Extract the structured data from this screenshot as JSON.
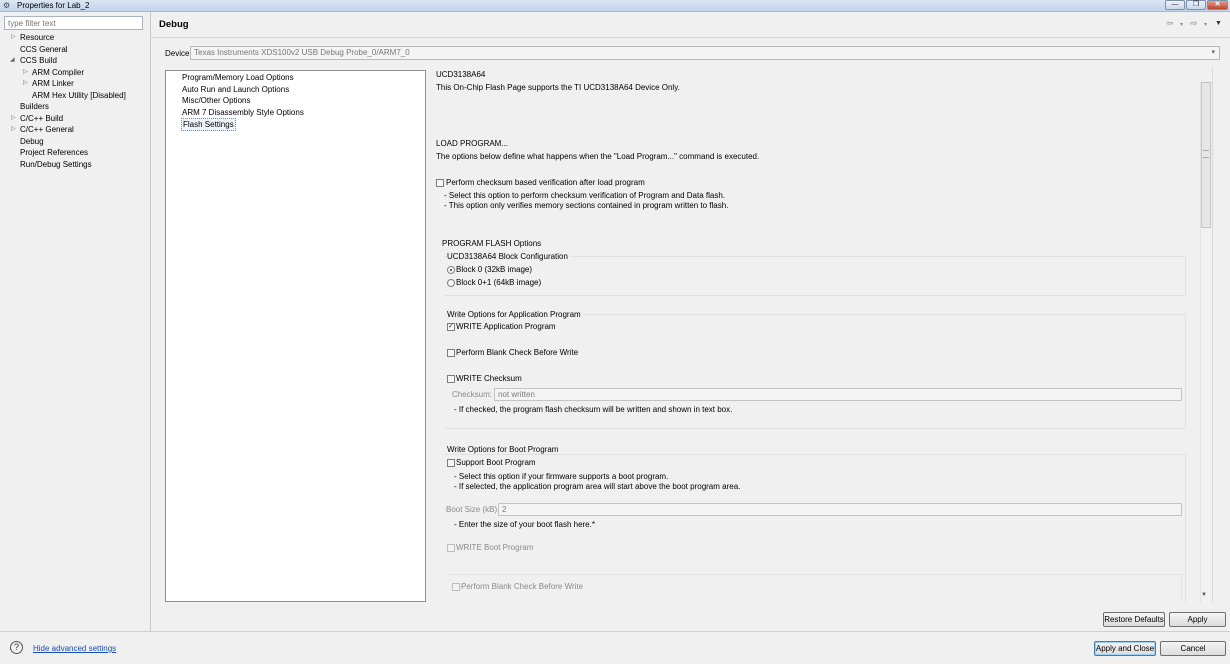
{
  "window": {
    "title": "Properties for Lab_2"
  },
  "filter": {
    "placeholder": "type filter text"
  },
  "tree": [
    {
      "label": "Resource",
      "arrow": "▷"
    },
    {
      "label": "CCS General",
      "arrow": ""
    },
    {
      "label": "CCS Build",
      "arrow": "◢"
    },
    {
      "label": "ARM Compiler",
      "arrow": "▷"
    },
    {
      "label": "ARM Linker",
      "arrow": "▷"
    },
    {
      "label": "ARM Hex Utility  [Disabled]",
      "arrow": ""
    },
    {
      "label": "Builders",
      "arrow": ""
    },
    {
      "label": "C/C++ Build",
      "arrow": "▷"
    },
    {
      "label": "C/C++ General",
      "arrow": "▷"
    },
    {
      "label": "Debug",
      "arrow": ""
    },
    {
      "label": "Project References",
      "arrow": ""
    },
    {
      "label": "Run/Debug Settings",
      "arrow": ""
    }
  ],
  "page": {
    "heading": "Debug"
  },
  "device": {
    "label": "Device",
    "value": "Texas Instruments XDS100v2 USB Debug Probe_0/ARM7_0"
  },
  "categories": [
    "Program/Memory Load Options",
    "Auto Run and Launch Options",
    "Misc/Other Options",
    "ARM 7 Disassembly Style Options",
    "Flash Settings"
  ],
  "content": {
    "device_title": "UCD3138A64",
    "device_desc": "This On-Chip Flash Page supports the TI UCD3138A64 Device Only.",
    "load_title": "LOAD PROGRAM...",
    "load_desc": "The options below define what happens when the \"Load Program...\" command is executed.",
    "checksum_verify": {
      "label": "Perform checksum based verification after load program",
      "checked": false,
      "notes": [
        "- Select this option to perform checksum verification of Program and Data flash.",
        "- This option only verifies memory sections contained in program written to flash."
      ]
    },
    "flash_options_title": "PROGRAM FLASH Options",
    "block_config": {
      "title": "UCD3138A64 Block Configuration",
      "options": [
        {
          "label": "Block 0 (32kB image)",
          "selected": true
        },
        {
          "label": "Block 0+1 (64kB image)",
          "selected": false
        }
      ]
    },
    "app_write": {
      "title": "Write Options for Application Program",
      "write_app": {
        "label": "WRITE Application Program",
        "checked": true
      },
      "blank_check": {
        "label": "Perform Blank Check Before Write",
        "checked": false
      },
      "write_checksum": {
        "label": "WRITE Checksum",
        "checked": false
      },
      "checksum_field": {
        "label": "Checksum:",
        "value": "not written"
      },
      "checksum_note": "- If checked, the program flash checksum will be written and shown in text box."
    },
    "boot_write": {
      "title": "Write Options for Boot Program",
      "support_boot": {
        "label": "Support Boot Program",
        "checked": false
      },
      "notes": [
        "- Select this option if your firmware supports a boot program.",
        "- If selected, the application program area will start above the boot program area."
      ],
      "boot_size": {
        "label": "Boot Size (kB):",
        "value": "2"
      },
      "boot_size_note": "- Enter the size of your boot flash here.*",
      "write_boot": {
        "label": "WRITE Boot Program",
        "checked": false
      },
      "blank_check": {
        "label": "Perform Blank Check Before Write",
        "checked": false
      }
    }
  },
  "buttons": {
    "restore_defaults": "Restore Defaults",
    "apply": "Apply",
    "apply_close": "Apply and Close",
    "cancel": "Cancel"
  },
  "footer": {
    "advanced_link": "Hide advanced settings",
    "help_icon": "?"
  }
}
